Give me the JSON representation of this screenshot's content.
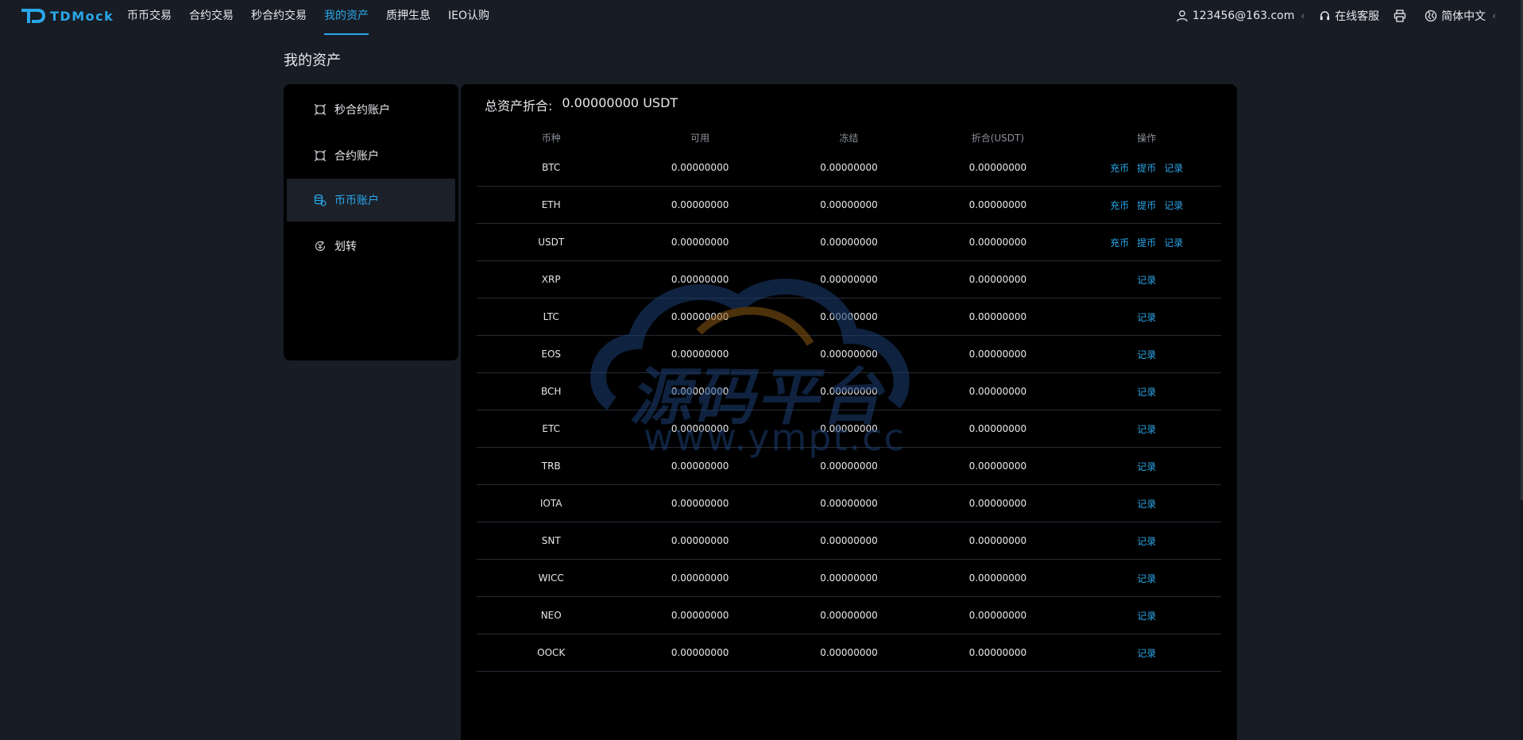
{
  "brand": {
    "name": "TDMock",
    "accent": "#2aa7ea"
  },
  "nav": {
    "items": [
      {
        "label": "币币交易"
      },
      {
        "label": "合约交易"
      },
      {
        "label": "秒合约交易"
      },
      {
        "label": "我的资产",
        "active": true
      },
      {
        "label": "质押生息"
      },
      {
        "label": "IEO认购"
      }
    ]
  },
  "header": {
    "user_email": "123456@163.com",
    "support_label": "在线客服",
    "language_label": "简体中文",
    "icons": [
      "user-icon",
      "headset-icon",
      "printer-icon",
      "globe-icon"
    ]
  },
  "page": {
    "title": "我的资产"
  },
  "sidebar": {
    "items": [
      {
        "label": "秒合约账户",
        "icon": "contract-icon"
      },
      {
        "label": "合约账户",
        "icon": "contract-icon"
      },
      {
        "label": "币币账户",
        "icon": "coins-icon",
        "active": true
      },
      {
        "label": "划转",
        "icon": "transfer-icon"
      }
    ]
  },
  "summary": {
    "label": "总资产折合:",
    "value": "0.00000000 USDT"
  },
  "table": {
    "headers": [
      "币种",
      "可用",
      "冻结",
      "折合(USDT)",
      "操作"
    ],
    "ops": {
      "deposit": "充币",
      "withdraw": "提币",
      "record": "记录"
    },
    "rows": [
      {
        "coin": "BTC",
        "available": "0.00000000",
        "frozen": "0.00000000",
        "usdt": "0.00000000",
        "full_ops": true
      },
      {
        "coin": "ETH",
        "available": "0.00000000",
        "frozen": "0.00000000",
        "usdt": "0.00000000",
        "full_ops": true
      },
      {
        "coin": "USDT",
        "available": "0.00000000",
        "frozen": "0.00000000",
        "usdt": "0.00000000",
        "full_ops": true
      },
      {
        "coin": "XRP",
        "available": "0.00000000",
        "frozen": "0.00000000",
        "usdt": "0.00000000",
        "full_ops": false
      },
      {
        "coin": "LTC",
        "available": "0.00000000",
        "frozen": "0.00000000",
        "usdt": "0.00000000",
        "full_ops": false
      },
      {
        "coin": "EOS",
        "available": "0.00000000",
        "frozen": "0.00000000",
        "usdt": "0.00000000",
        "full_ops": false
      },
      {
        "coin": "BCH",
        "available": "0.00000000",
        "frozen": "0.00000000",
        "usdt": "0.00000000",
        "full_ops": false
      },
      {
        "coin": "ETC",
        "available": "0.00000000",
        "frozen": "0.00000000",
        "usdt": "0.00000000",
        "full_ops": false
      },
      {
        "coin": "TRB",
        "available": "0.00000000",
        "frozen": "0.00000000",
        "usdt": "0.00000000",
        "full_ops": false
      },
      {
        "coin": "IOTA",
        "available": "0.00000000",
        "frozen": "0.00000000",
        "usdt": "0.00000000",
        "full_ops": false
      },
      {
        "coin": "SNT",
        "available": "0.00000000",
        "frozen": "0.00000000",
        "usdt": "0.00000000",
        "full_ops": false
      },
      {
        "coin": "WICC",
        "available": "0.00000000",
        "frozen": "0.00000000",
        "usdt": "0.00000000",
        "full_ops": false
      },
      {
        "coin": "NEO",
        "available": "0.00000000",
        "frozen": "0.00000000",
        "usdt": "0.00000000",
        "full_ops": false
      },
      {
        "coin": "OOCK",
        "available": "0.00000000",
        "frozen": "0.00000000",
        "usdt": "0.00000000",
        "full_ops": false
      }
    ]
  },
  "watermark": {
    "text": "源码平台",
    "url": "www.ympt.cc"
  }
}
